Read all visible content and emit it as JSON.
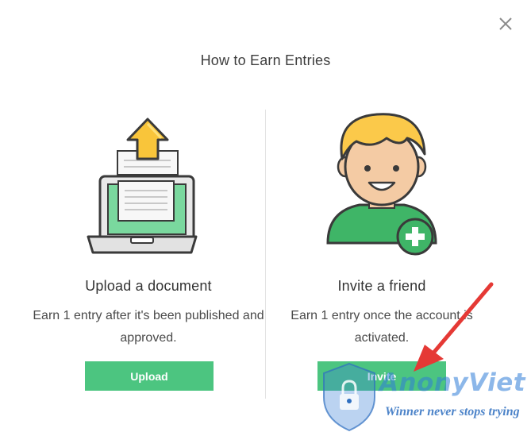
{
  "dialog": {
    "title": "How to Earn Entries",
    "close_icon": "close-icon"
  },
  "options": [
    {
      "title": "Upload a document",
      "description": "Earn 1 entry after it's been published and approved.",
      "button_label": "Upload",
      "icon": "laptop-upload-illustration"
    },
    {
      "title": "Invite a friend",
      "description": "Earn 1 entry once the account is activated.",
      "button_label": "Invite",
      "icon": "person-add-illustration"
    }
  ],
  "colors": {
    "accent_green": "#4cc580",
    "arrow_red": "#e53935",
    "watermark_blue": "#2f7ed8"
  },
  "watermark": {
    "brand": "AnonyViet",
    "tagline": "Winner never stops trying"
  }
}
